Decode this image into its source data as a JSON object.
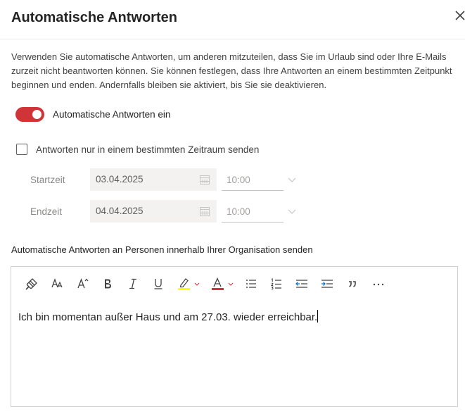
{
  "dialog": {
    "title": "Automatische Antworten",
    "close_icon": "close-icon"
  },
  "description": "Verwenden Sie automatische Antworten, um anderen mitzuteilen, dass Sie im Urlaub sind oder Ihre E-Mails zurzeit nicht beantworten können. Sie können festlegen, dass Ihre Antworten an einem bestimmten Zeitpunkt beginnen und enden. Andernfalls bleiben sie aktiviert, bis Sie sie deaktivieren.",
  "auto_reply_toggle": {
    "label": "Automatische Antworten ein",
    "on": true,
    "color": "#d13438"
  },
  "time_range_checkbox": {
    "label": "Antworten nur in einem bestimmten Zeitraum senden",
    "checked": false
  },
  "start": {
    "label": "Startzeit",
    "date": "03.04.2025",
    "time": "10:00"
  },
  "end": {
    "label": "Endzeit",
    "date": "04.04.2025",
    "time": "10:00"
  },
  "internal_section": {
    "label": "Automatische Antworten an Personen innerhalb Ihrer Organisation senden",
    "toolbar": [
      "format-painter-icon",
      "font-size-icon",
      "increase-font-size-icon",
      "bold-icon",
      "italic-icon",
      "underline-icon",
      "highlight-icon",
      "font-color-icon",
      "bullet-list-icon",
      "numbered-list-icon",
      "decrease-indent-icon",
      "increase-indent-icon",
      "quote-icon",
      "more-options-icon"
    ],
    "highlight_color": "#ffff00",
    "font_color": "#d13438",
    "message": "Ich bin momentan außer Haus und am 27.03. wieder erreichbar."
  }
}
